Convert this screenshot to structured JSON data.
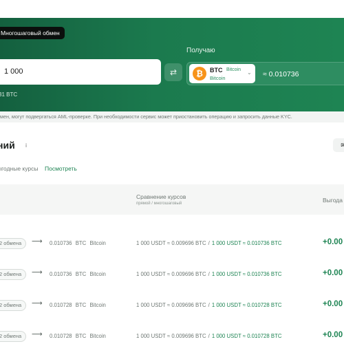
{
  "hero": {
    "tab_label": "Многошаговый обмен",
    "receive_label": "Получаю",
    "amount_value": "1 000",
    "swap_icon": "swap-arrows-icon",
    "coin": {
      "ticker": "BTC",
      "network_short": "Bitcoin",
      "network": "Bitcoin",
      "icon": "bitcoin-icon",
      "color": "#f7931a"
    },
    "receive_value": "≈ 0.010736",
    "min_text": "31 BTC",
    "accent": "#1e8453"
  },
  "notice": "мен, могут подвергаться AML-проверке. При необходимости сервис может приостановить операцию и запросить данные KYC.",
  "section": {
    "title": "ний",
    "info_icon": "info-icon",
    "mail_icon": "mail-icon",
    "rates_hint": "ыгодные курсы",
    "view_link": "Посмотреть"
  },
  "table": {
    "header_compare": "Сравнение курсов",
    "header_compare_sub": "прямой / многошаговый",
    "header_benefit": "Выгода",
    "rows": [
      {
        "steps": "2 обмена",
        "amount": "0.010736",
        "ticker": "BTC",
        "network": "Bitcoin",
        "direct": "1 000 USDT ≈ 0.009696 BTC",
        "multi": "1 000 USDT ≈ 0.010736 BTC",
        "benefit": "+0.00"
      },
      {
        "steps": "2 обмена",
        "amount": "0.010736",
        "ticker": "BTC",
        "network": "Bitcoin",
        "direct": "1 000 USDT ≈ 0.009696 BTC",
        "multi": "1 000 USDT ≈ 0.010736 BTC",
        "benefit": "+0.00"
      },
      {
        "steps": "2 обмена",
        "amount": "0.010728",
        "ticker": "BTC",
        "network": "Bitcoin",
        "direct": "1 000 USDT ≈ 0.009696 BTC",
        "multi": "1 000 USDT ≈ 0.010728 BTC",
        "benefit": "+0.00"
      },
      {
        "steps": "2 обмена",
        "amount": "0.010728",
        "ticker": "BTC",
        "network": "Bitcoin",
        "direct": "1 000 USDT ≈ 0.009696 BTC",
        "multi": "1 000 USDT ≈ 0.010728 BTC",
        "benefit": "+0.00"
      }
    ]
  }
}
